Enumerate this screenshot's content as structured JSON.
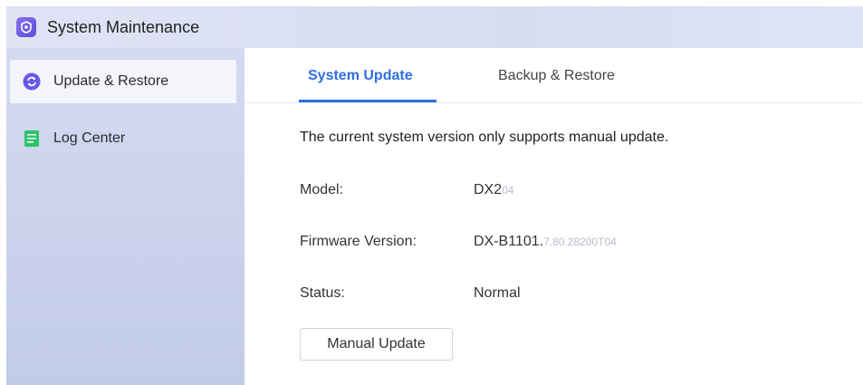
{
  "window": {
    "title": "System Maintenance",
    "app_icon": "system-maintenance-icon"
  },
  "sidebar": {
    "items": [
      {
        "label": "Update & Restore",
        "icon": "refresh-icon",
        "active": true,
        "color": "#6b57e6"
      },
      {
        "label": "Log Center",
        "icon": "log-icon",
        "active": false,
        "color": "#2fc36a"
      }
    ]
  },
  "tabs": [
    {
      "label": "System Update",
      "active": true
    },
    {
      "label": "Backup & Restore",
      "active": false
    }
  ],
  "main": {
    "notice": "The current system version only supports manual update.",
    "fields": [
      {
        "label": "Model:",
        "value_prefix": "DX2",
        "value_redacted": "04"
      },
      {
        "label": "Firmware Version:",
        "value_prefix": "DX-B1101.",
        "value_redacted": "7.80.28200T04"
      },
      {
        "label": "Status:",
        "value_prefix": "Normal",
        "value_redacted": ""
      }
    ],
    "manual_update_button": "Manual Update"
  },
  "colors": {
    "accent": "#2f6fe0",
    "sidebar_bg": "#cfd6ee",
    "titlebar_bg": "#dce1f3"
  }
}
